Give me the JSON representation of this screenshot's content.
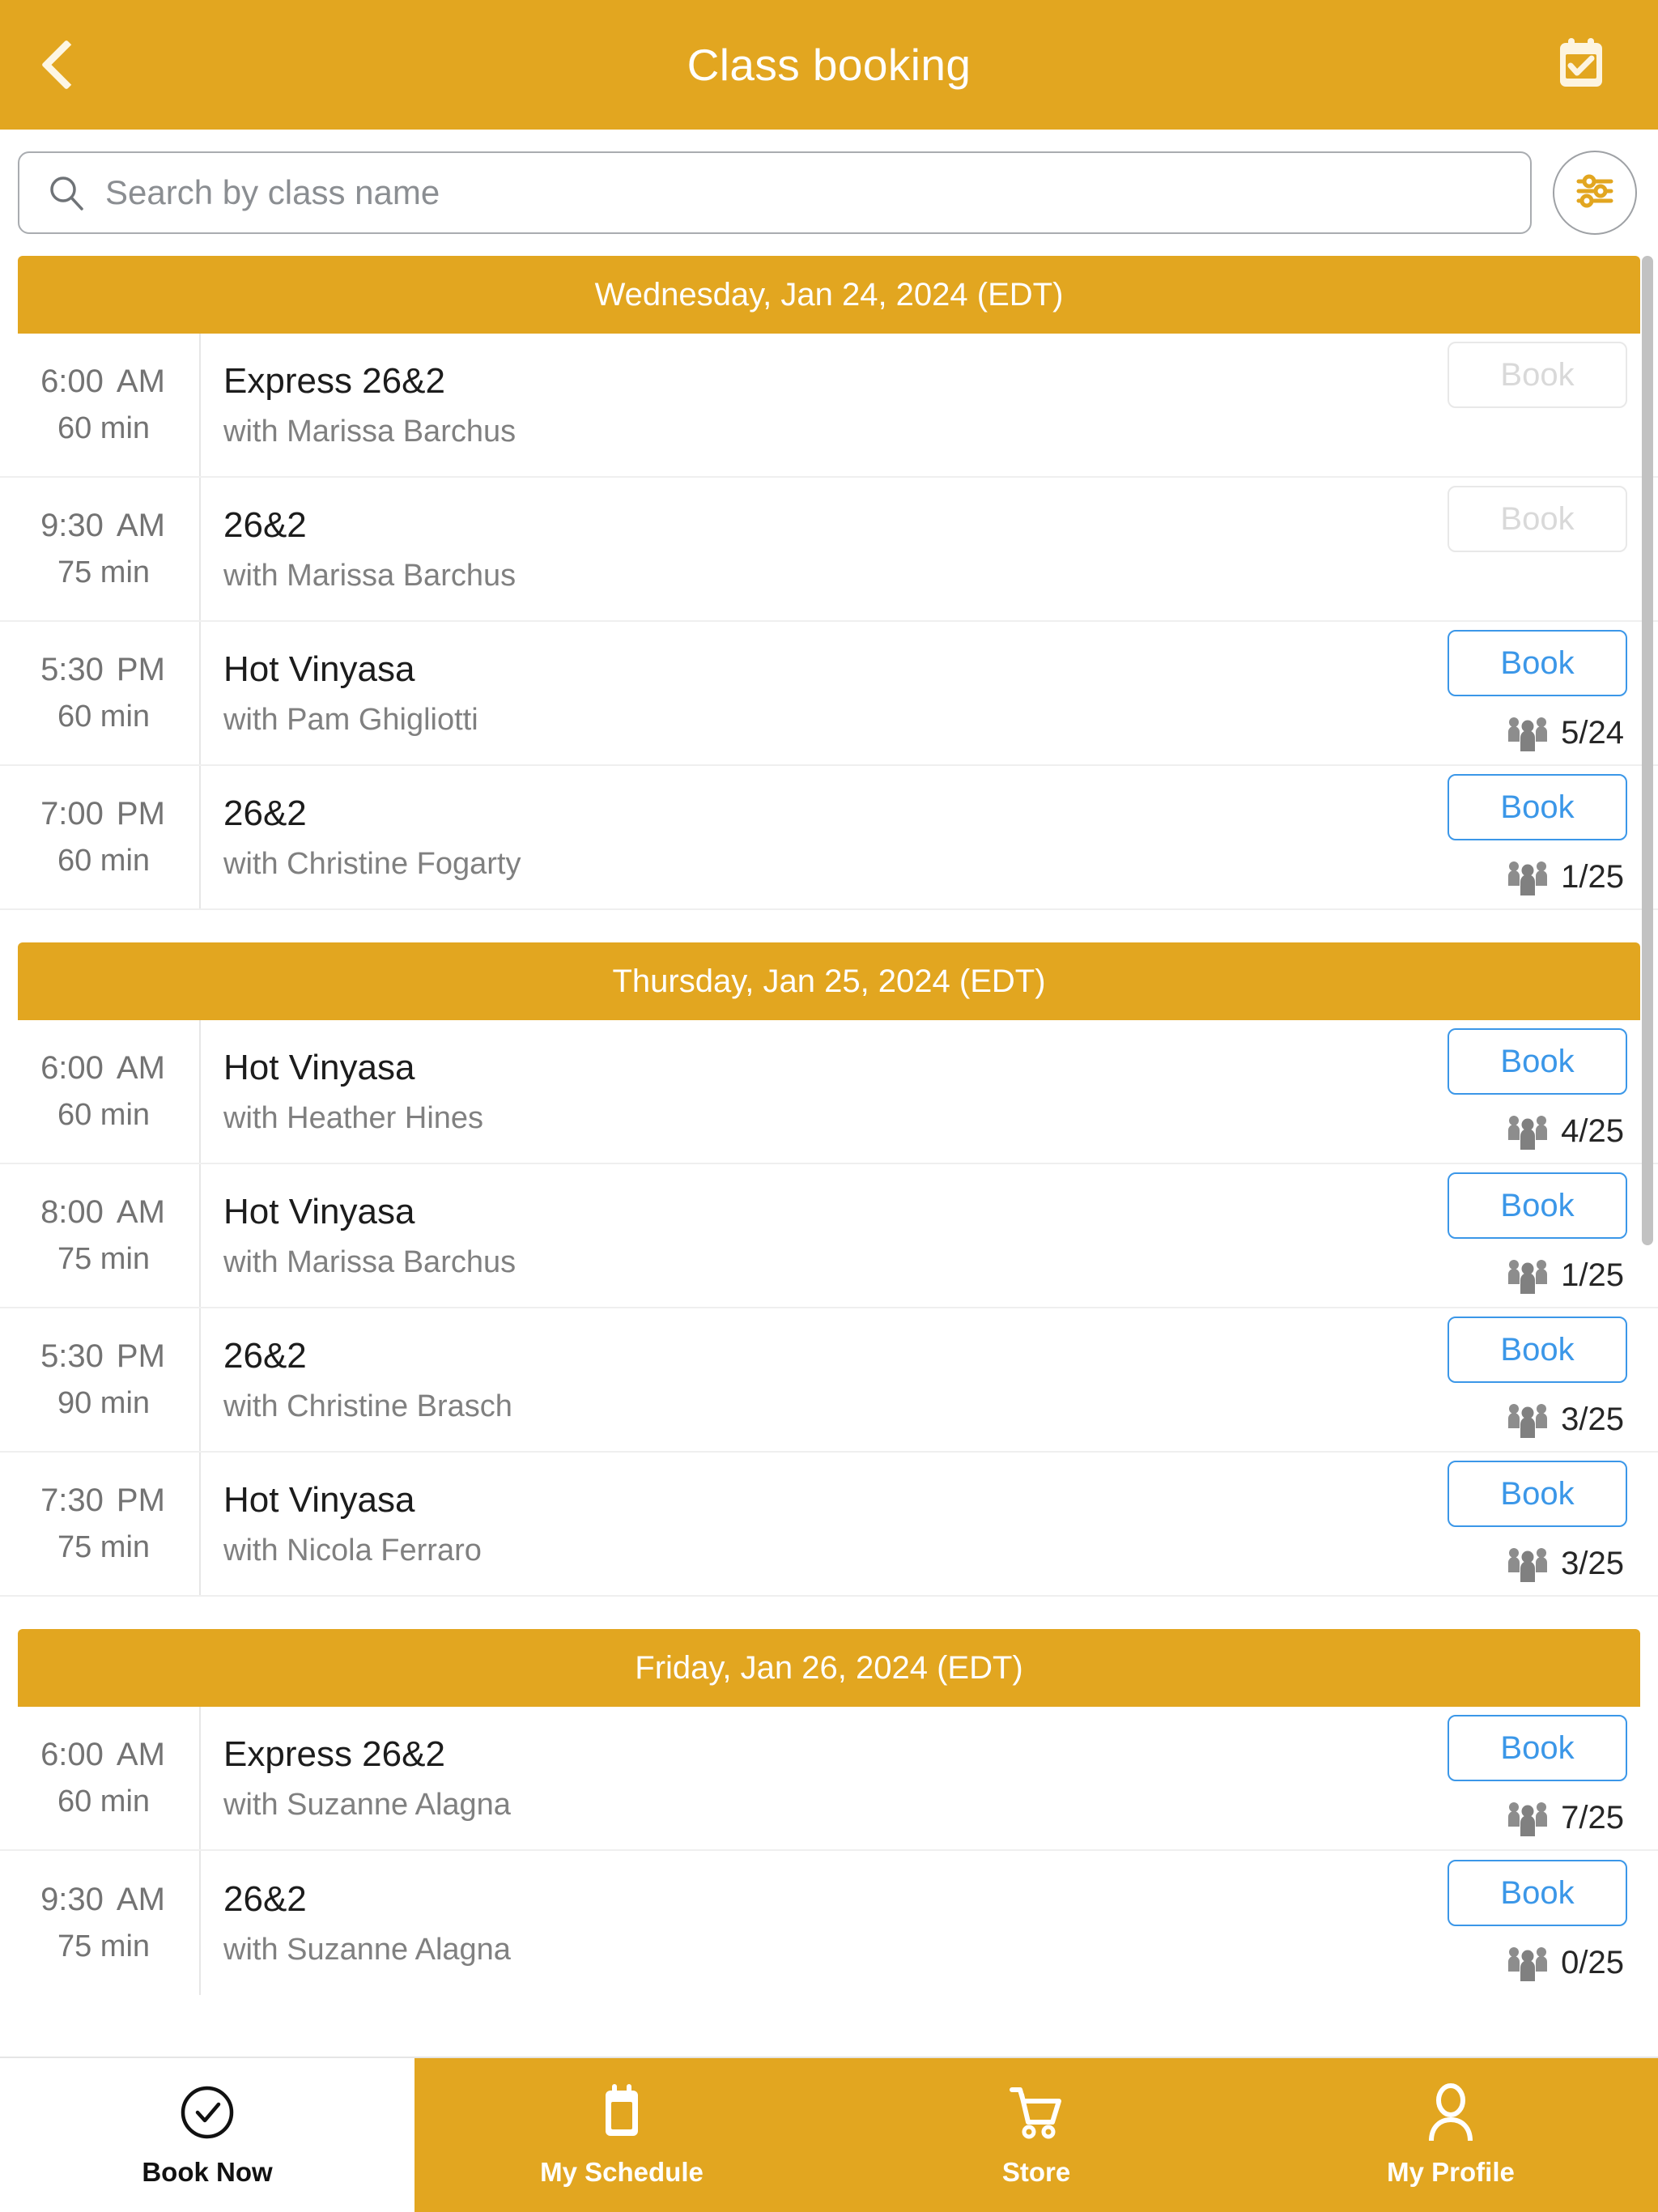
{
  "header": {
    "title": "Class booking",
    "back_icon": "chevron-left-icon",
    "calendar_icon": "calendar-check-icon",
    "bg_color": "#e2a620"
  },
  "search": {
    "placeholder": "Search by class name",
    "value": "",
    "search_icon": "search-icon",
    "filter_icon": "sliders-filter-icon",
    "filter_color": "#e2a620"
  },
  "accent_colors": {
    "brand_yellow": "#e2a620",
    "book_blue": "#3b97e8",
    "disabled_gray": "#d9d9d9"
  },
  "days": [
    {
      "label": "Wednesday, Jan 24, 2024 (EDT)",
      "classes": [
        {
          "time": "6:00",
          "ampm": "AM",
          "duration": "60 min",
          "name": "Express 26&2",
          "teacher": "with Marissa Barchus",
          "book_label": "Book",
          "enabled": false,
          "capacity": "",
          "show_capacity": false
        },
        {
          "time": "9:30",
          "ampm": "AM",
          "duration": "75 min",
          "name": "26&2",
          "teacher": "with Marissa Barchus",
          "book_label": "Book",
          "enabled": false,
          "capacity": "",
          "show_capacity": false
        },
        {
          "time": "5:30",
          "ampm": "PM",
          "duration": "60 min",
          "name": "Hot Vinyasa",
          "teacher": "with Pam Ghigliotti",
          "book_label": "Book",
          "enabled": true,
          "capacity": "5/24",
          "show_capacity": true
        },
        {
          "time": "7:00",
          "ampm": "PM",
          "duration": "60 min",
          "name": "26&2",
          "teacher": "with Christine Fogarty",
          "book_label": "Book",
          "enabled": true,
          "capacity": "1/25",
          "show_capacity": true
        }
      ]
    },
    {
      "label": "Thursday, Jan 25, 2024 (EDT)",
      "classes": [
        {
          "time": "6:00",
          "ampm": "AM",
          "duration": "60 min",
          "name": "Hot Vinyasa",
          "teacher": "with Heather Hines",
          "book_label": "Book",
          "enabled": true,
          "capacity": "4/25",
          "show_capacity": true
        },
        {
          "time": "8:00",
          "ampm": "AM",
          "duration": "75 min",
          "name": "Hot Vinyasa",
          "teacher": "with Marissa Barchus",
          "book_label": "Book",
          "enabled": true,
          "capacity": "1/25",
          "show_capacity": true
        },
        {
          "time": "5:30",
          "ampm": "PM",
          "duration": "90 min",
          "name": "26&2",
          "teacher": "with Christine Brasch",
          "book_label": "Book",
          "enabled": true,
          "capacity": "3/25",
          "show_capacity": true
        },
        {
          "time": "7:30",
          "ampm": "PM",
          "duration": "75 min",
          "name": "Hot Vinyasa",
          "teacher": "with Nicola Ferraro",
          "book_label": "Book",
          "enabled": true,
          "capacity": "3/25",
          "show_capacity": true
        }
      ]
    },
    {
      "label": "Friday, Jan 26, 2024 (EDT)",
      "classes": [
        {
          "time": "6:00",
          "ampm": "AM",
          "duration": "60 min",
          "name": "Express 26&2",
          "teacher": "with Suzanne Alagna",
          "book_label": "Book",
          "enabled": true,
          "capacity": "7/25",
          "show_capacity": true
        },
        {
          "time": "9:30",
          "ampm": "AM",
          "duration": "75 min",
          "name": "26&2",
          "teacher": "with Suzanne Alagna",
          "book_label": "Book",
          "enabled": true,
          "capacity": "0/25",
          "show_capacity": true
        }
      ]
    }
  ],
  "bottom_nav": [
    {
      "label": "Book Now",
      "icon": "check-circle-icon",
      "active": true
    },
    {
      "label": "My Schedule",
      "icon": "calendar-icon",
      "active": false
    },
    {
      "label": "Store",
      "icon": "shopping-cart-icon",
      "active": false
    },
    {
      "label": "My Profile",
      "icon": "person-icon",
      "active": false
    }
  ]
}
